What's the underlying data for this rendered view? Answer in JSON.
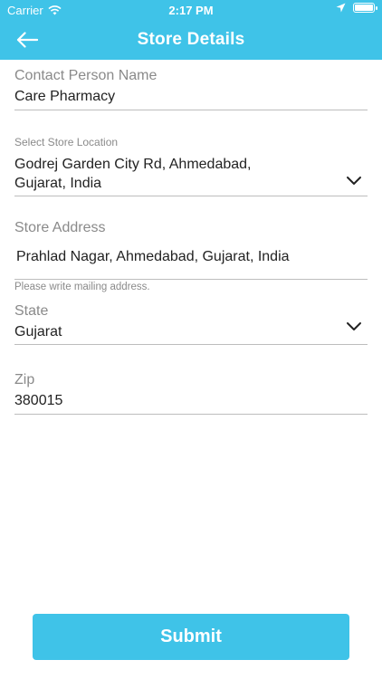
{
  "status_bar": {
    "carrier": "Carrier",
    "time": "2:17 PM"
  },
  "header": {
    "title": "Store Details"
  },
  "form": {
    "contact_person": {
      "label": "Contact Person Name",
      "value": "Care Pharmacy"
    },
    "store_location": {
      "label": "Select Store Location",
      "value_line1": "Godrej Garden City Rd, Ahmedabad,",
      "value_line2": "Gujarat, India"
    },
    "store_address": {
      "label": "Store Address",
      "value": "Prahlad Nagar, Ahmedabad, Gujarat, India",
      "helper": "Please write mailing address."
    },
    "state": {
      "label": "State",
      "value": "Gujarat"
    },
    "zip": {
      "label": "Zip",
      "value": "380015"
    }
  },
  "submit_label": "Submit",
  "colors": {
    "accent": "#3fc3e8",
    "text": "#222222",
    "label": "#8a8a8a",
    "divider": "#bdbdbd"
  },
  "icons": {
    "back": "arrow-left-icon",
    "dropdown": "chevron-down-icon",
    "wifi": "wifi-icon",
    "location": "location-arrow-icon",
    "battery": "battery-icon"
  }
}
